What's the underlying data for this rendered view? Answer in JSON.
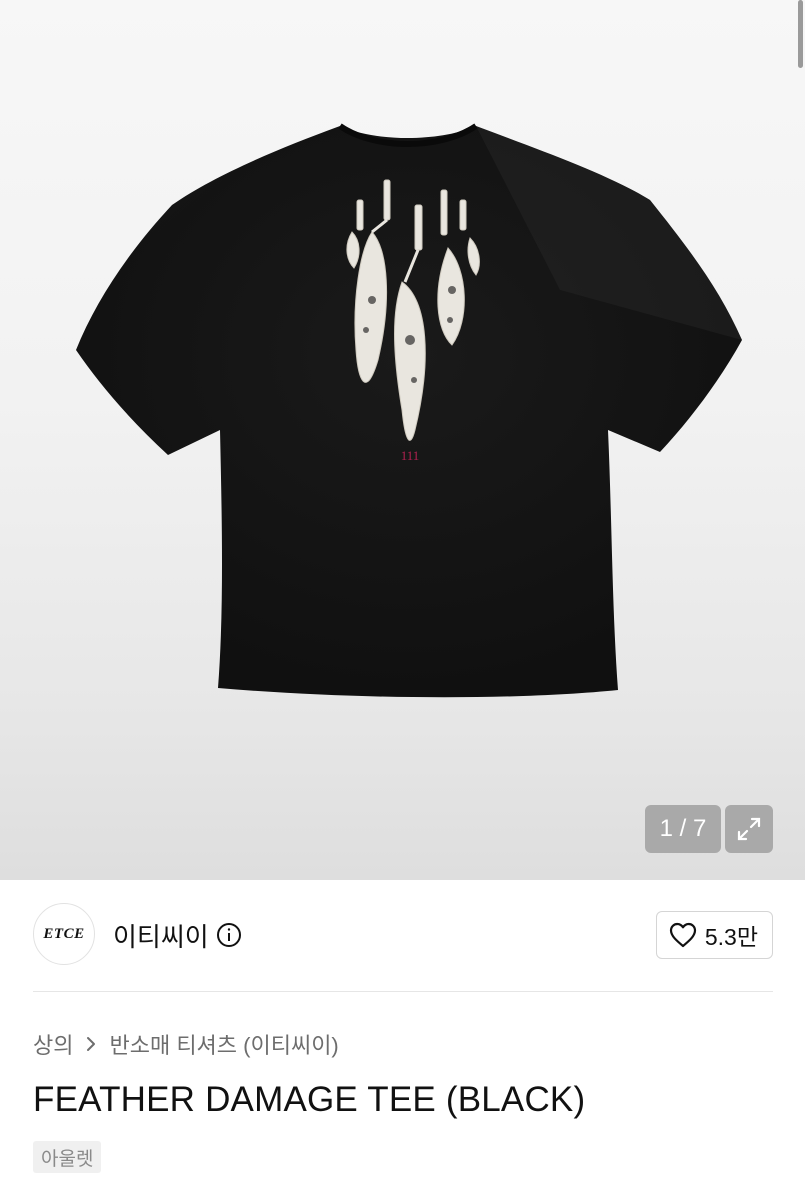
{
  "gallery": {
    "counter": "1 / 7",
    "image_alt": "FEATHER DAMAGE TEE (BLACK)",
    "print_label": "111",
    "icons": {
      "expand": "expand-icon"
    }
  },
  "brand": {
    "logo_text": "ETCE",
    "name": "이티씨이",
    "icons": {
      "info": "info-icon",
      "like": "heart-icon"
    },
    "likes": "5.3만"
  },
  "breadcrumb": {
    "category": "상의",
    "subcategory": "반소매 티셔츠 (이티씨이)",
    "icons": {
      "separator": "chevron-right-icon"
    }
  },
  "product": {
    "title": "FEATHER DAMAGE TEE (BLACK)",
    "tag": "아울렛"
  },
  "colors": {
    "shirt": "#111111",
    "print": "#e9e6df",
    "accent_print": "#b0204f",
    "overlay": "#a9a9a9"
  }
}
